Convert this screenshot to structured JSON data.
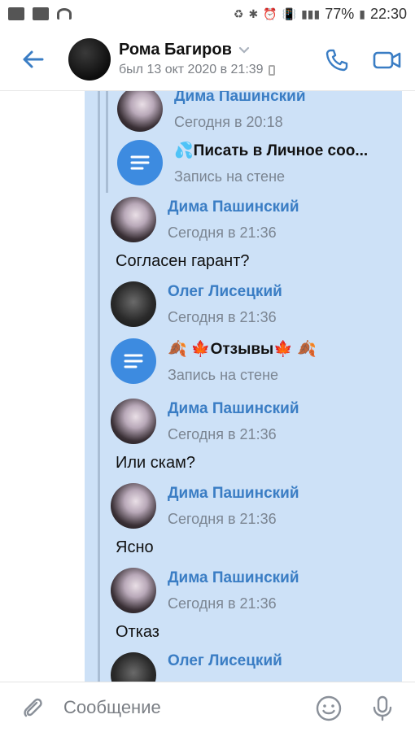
{
  "status_bar": {
    "battery": "77%",
    "time": "22:30"
  },
  "header": {
    "title": "Рома Багиров",
    "subtitle": "был 13 окт 2020 в 21:39"
  },
  "messages": [
    {
      "author": "Дима Пашинский",
      "time": "Сегодня в 20:18"
    },
    {
      "title": "💦Писать в Личное соо...",
      "subtitle": "Запись на стене"
    },
    {
      "author": "Дима Пашинский",
      "time": "Сегодня в 21:36",
      "text": "Согласен гарант?"
    },
    {
      "author": "Олег Лисецкий",
      "time": "Сегодня в 21:36"
    },
    {
      "title": "🍂 🍁Отзывы🍁 🍂",
      "subtitle": "Запись на стене"
    },
    {
      "author": "Дима Пашинский",
      "time": "Сегодня в 21:36",
      "text": "Или скам?"
    },
    {
      "author": "Дима Пашинский",
      "time": "Сегодня в 21:36",
      "text": "Ясно"
    },
    {
      "author": "Дима Пашинский",
      "time": "Сегодня в 21:36",
      "text": "Отказ"
    },
    {
      "author": "Олег Лисецкий"
    }
  ],
  "composer": {
    "placeholder": "Сообщение"
  },
  "colors": {
    "accent": "#3a7dc4",
    "bubble": "#cde1f7",
    "doc_icon": "#3d8be0"
  }
}
